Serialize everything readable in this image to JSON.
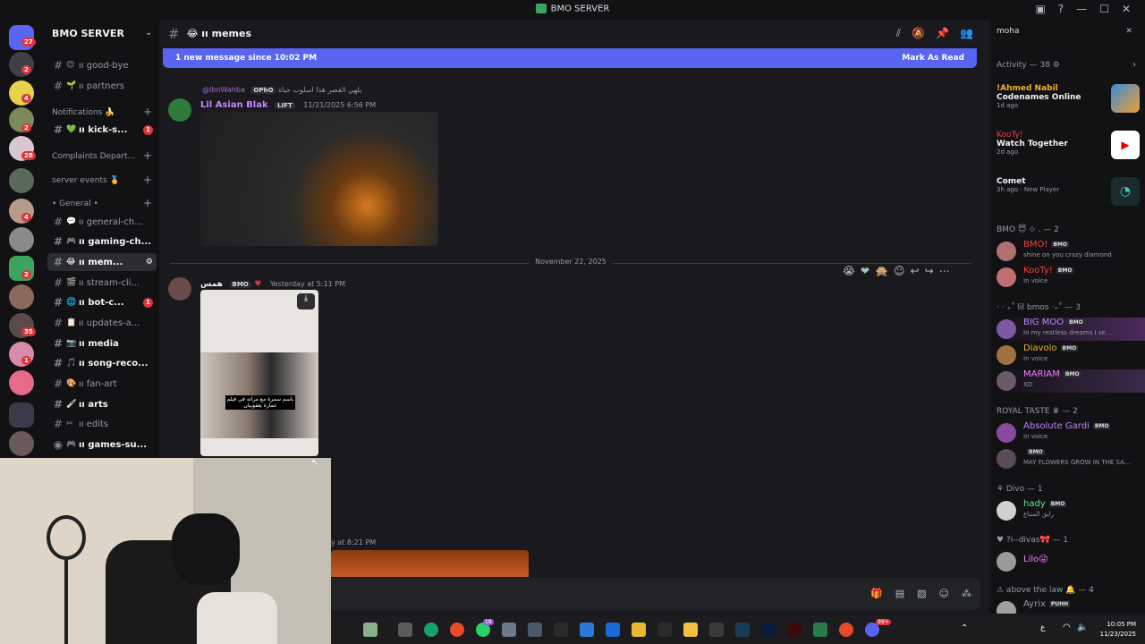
{
  "window": {
    "title": "BMO SERVER"
  },
  "guild_badges": [
    "27",
    "2",
    "4",
    "2",
    "28",
    "4",
    "2",
    "35",
    "1"
  ],
  "server": {
    "name": "BMO SERVER"
  },
  "channels": [
    {
      "emoji": "😊",
      "label": "ıı good-bye",
      "unread": false
    },
    {
      "emoji": "🌱",
      "label": "ıı partners",
      "unread": false
    }
  ],
  "categories": {
    "notifications": "Notifications 🍌",
    "complaints": "Complaints Depart...",
    "server_events": "server events 🥇",
    "general": "• General •"
  },
  "notif_channels": [
    {
      "emoji": "💚",
      "label": "ıı kick-s...",
      "badge": "1"
    }
  ],
  "general_channels": [
    {
      "emoji": "💬",
      "label": "ıı general-ch...",
      "unread": false
    },
    {
      "emoji": "🎮",
      "label": "ıı gaming-ch...",
      "unread": true
    },
    {
      "emoji": "😂",
      "label": "ıı mem...",
      "unread": true,
      "active": true
    },
    {
      "emoji": "🎬",
      "label": "ıı stream-cli...",
      "unread": false
    },
    {
      "emoji": "🌐",
      "label": "ıı bot-c...",
      "unread": true,
      "badge": "1"
    },
    {
      "emoji": "📋",
      "label": "ıı updates-a...",
      "unread": false
    },
    {
      "emoji": "📷",
      "label": "ıı media",
      "unread": true
    },
    {
      "emoji": "🎵",
      "label": "ıı song-reco...",
      "unread": true
    },
    {
      "emoji": "🎨",
      "label": "ıı fan-art",
      "unread": false
    },
    {
      "emoji": "🖌",
      "label": "ıı arts",
      "unread": true
    },
    {
      "emoji": "✂",
      "label": "ıı edits",
      "unread": false
    },
    {
      "emoji": "🎮",
      "label": "ıı games-su...",
      "unread": true
    }
  ],
  "chat": {
    "channel": "😂 ıı memes",
    "new_message_bar": "1 new message since 10:02 PM",
    "mark_as_read": "Mark As Read"
  },
  "messages": {
    "reply_name": "@IbnWahba",
    "reply_tag": "OPhO",
    "reply_text": "يلهي القصر هذا اسلوب حياة",
    "m1_name": "Lil Asian Blak",
    "m1_tag": "LIFT",
    "m1_time": "11/21/2025 6:56 PM",
    "date_divider": "November 22, 2025",
    "m2_name": "همس",
    "m2_tag": "BMO",
    "m2_time": "Yesterday at 5:11 PM",
    "m2_caption": "باسم سمرة مع مراته في فيلم عمارة يعقوبيان",
    "m3_time": "y at 8:21 PM"
  },
  "search": {
    "value": "moha"
  },
  "activity": {
    "header": "Activity — 38 ⚙",
    "items": [
      {
        "name": "!Ahmed Nabil",
        "app": "Codenames Online",
        "time": "1d ago",
        "color": "#f0b232"
      },
      {
        "name": "KooTy!",
        "app": "Watch Together",
        "time": "2d ago",
        "color": "#ed4245"
      },
      {
        "name": "",
        "app": "Comet",
        "time": "3h ago",
        "extra": "New Player",
        "color": "#5865f2"
      }
    ]
  },
  "member_groups": [
    {
      "title": "BMO 😇 ⊹ . — 2",
      "members": [
        {
          "name": "BMO!",
          "tag": "BMO",
          "status": "shine on you crazy diamond",
          "color": "#f23f43"
        },
        {
          "name": "KooTy!",
          "tag": "BMO",
          "status": "In voice",
          "color": "#f23f43"
        }
      ]
    },
    {
      "title": "· ‧ ₊˚ lil bmos ‧₊˚ — 3",
      "members": [
        {
          "name": "BIG MOO",
          "tag": "BMO",
          "status": "In my restless dreams I se...",
          "color": "#c084fc"
        },
        {
          "name": "Diavolo",
          "tag": "BMO",
          "status": "In voice",
          "color": "#f0b232"
        },
        {
          "name": "MARIAM",
          "tag": "BMO",
          "status": "XD",
          "color": "#f47fff"
        }
      ]
    },
    {
      "title": "ROYAL TASTE ♛ — 2",
      "members": [
        {
          "name": "Absolute Gardi",
          "tag": "BMO",
          "status": "In voice",
          "color": "#c084fc"
        },
        {
          "name": "",
          "tag": "BMO",
          "status": "MAY FLOWERS GROW IN THE SA...",
          "color": "#c084fc"
        }
      ]
    },
    {
      "title": "⚘ Divo — 1",
      "members": [
        {
          "name": "hady",
          "tag": "BMO",
          "status": "رايق المتباع",
          "color": "#57f287"
        }
      ]
    },
    {
      "title": "♥ ?i--divas🎀 — 1",
      "members": [
        {
          "name": "Lilo😜",
          "tag": "",
          "status": "",
          "color": "#f47fff"
        }
      ]
    },
    {
      "title": "⚠ above the law 🔔 — 4",
      "members": [
        {
          "name": "Ayrix",
          "tag": "PUHH",
          "status": "",
          "color": "#949ba4"
        }
      ]
    }
  ],
  "clock": {
    "time": "10:05 PM",
    "date": "11/23/2025"
  },
  "taskbar_lang": "ع",
  "taskbar_badges": {
    "a": "18",
    "b": "99+"
  }
}
